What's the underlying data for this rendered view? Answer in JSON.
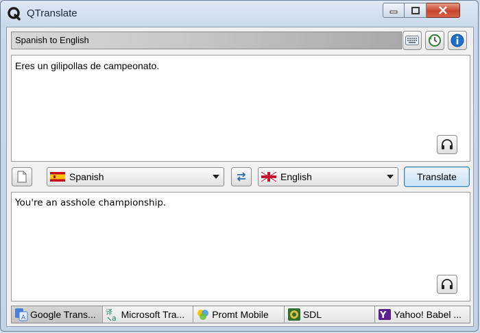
{
  "window": {
    "title": "QTranslate"
  },
  "toolbar": {
    "direction_label": "Spanish to English",
    "icons": [
      "keyboard-icon",
      "history-icon",
      "info-icon"
    ]
  },
  "source": {
    "text": "Eres un gilipollas de campeonato."
  },
  "controls": {
    "source_language": "Spanish",
    "target_language": "English",
    "translate_label": "Translate"
  },
  "result": {
    "text": "You're an asshole championship."
  },
  "engines": [
    {
      "label": "Google Trans...",
      "icon": "google-translate-icon",
      "active": true
    },
    {
      "label": "Microsoft Tra...",
      "icon": "microsoft-translator-icon",
      "active": false
    },
    {
      "label": "Promt Mobile",
      "icon": "promt-icon",
      "active": false
    },
    {
      "label": "SDL",
      "icon": "sdl-icon",
      "active": false
    },
    {
      "label": "Yahoo! Babel ...",
      "icon": "yahoo-icon",
      "active": false
    }
  ],
  "colors": {
    "accent": "#3c7fb1",
    "close": "#c6452c",
    "info": "#1e6fc9"
  }
}
